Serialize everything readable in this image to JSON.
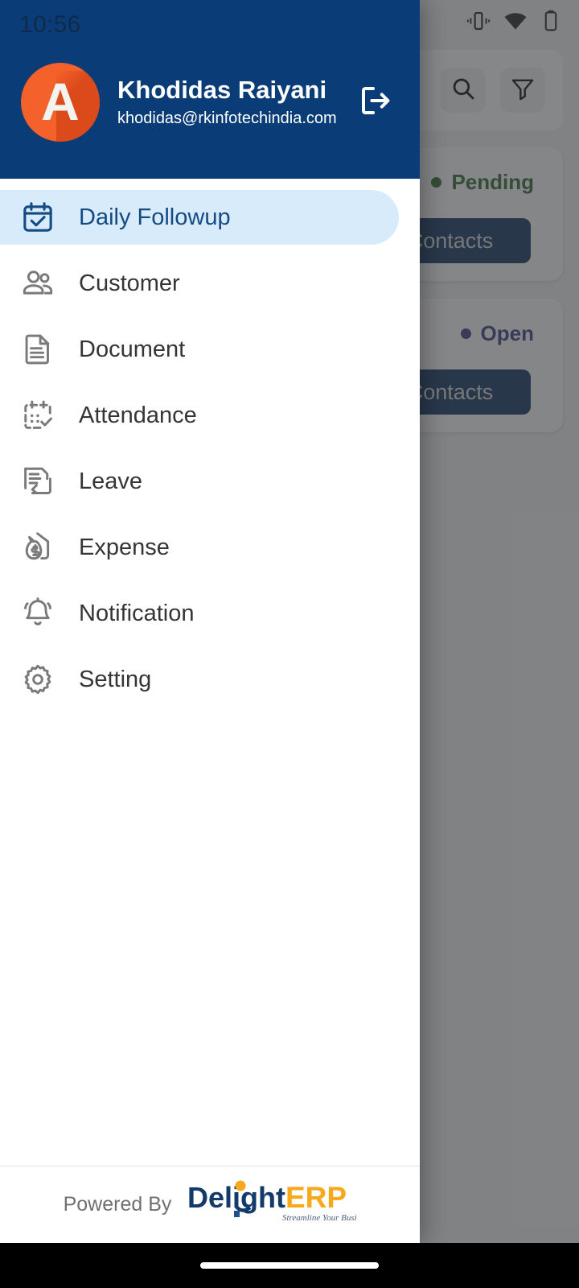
{
  "status_bar": {
    "time": "10:56",
    "icons": [
      "vibrate-icon",
      "wifi-icon",
      "battery-icon"
    ]
  },
  "drawer": {
    "header": {
      "avatar_letter": "A",
      "avatar_color": "#f4612a",
      "name": "Khodidas Raiyani",
      "email": "khodidas@rkinfotechindia.com",
      "logout_icon": "logout-icon",
      "background_color": "#0a3d77"
    },
    "menu": [
      {
        "label": "Daily Followup",
        "icon": "calendar-check-icon",
        "selected": true
      },
      {
        "label": "Customer",
        "icon": "users-icon",
        "selected": false
      },
      {
        "label": "Document",
        "icon": "document-icon",
        "selected": false
      },
      {
        "label": "Attendance",
        "icon": "calendar-dots-check-icon",
        "selected": false
      },
      {
        "label": "Leave",
        "icon": "leave-request-icon",
        "selected": false
      },
      {
        "label": "Expense",
        "icon": "money-bag-icon",
        "selected": false
      },
      {
        "label": "Notification",
        "icon": "bell-icon",
        "selected": false
      },
      {
        "label": "Setting",
        "icon": "gear-icon",
        "selected": false
      }
    ],
    "selected_highlight_color": "#d7ebfb",
    "selected_text_color": "#164a84",
    "footer": {
      "powered_by": "Powered By",
      "brand_part1": "Delight",
      "brand_part2": "ERP",
      "brand_tagline": "Streamline Your Business...",
      "brand_color_primary": "#123a6b",
      "brand_color_accent": "#f7a81b"
    }
  },
  "background": {
    "toolbar": {
      "search_icon": "search-icon",
      "filter_icon": "filter-icon"
    },
    "cards": [
      {
        "status": "Pending",
        "status_color": "#2f6b2f",
        "button_label": "Contacts"
      },
      {
        "status": "Open",
        "status_color": "#3b3f84",
        "button_label": "Contacts"
      }
    ]
  }
}
